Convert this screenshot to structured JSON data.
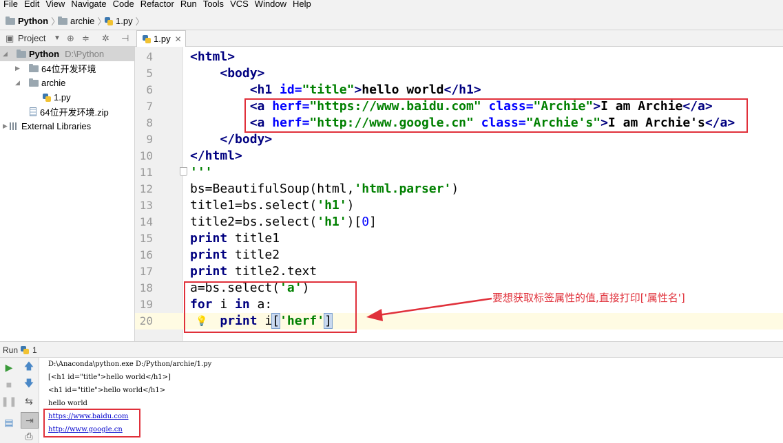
{
  "menu": [
    "File",
    "Edit",
    "View",
    "Navigate",
    "Code",
    "Refactor",
    "Run",
    "Tools",
    "VCS",
    "Window",
    "Help"
  ],
  "breadcrumb": {
    "project": "Python",
    "folder": "archie",
    "file": "1.py"
  },
  "project_panel": {
    "label": "Project",
    "tree": [
      {
        "label": "Python",
        "path": "D:\\Python"
      },
      {
        "label": "64位开发环境"
      },
      {
        "label": "archie"
      },
      {
        "label": "1.py"
      },
      {
        "label": "64位开发环境.zip"
      },
      {
        "label": "External Libraries"
      }
    ]
  },
  "editor": {
    "tab": "1.py",
    "line_numbers": [
      "4",
      "5",
      "6",
      "7",
      "8",
      "9",
      "10",
      "11",
      "12",
      "13",
      "14",
      "15",
      "16",
      "17",
      "18",
      "19",
      "20"
    ],
    "code": [
      "<html>",
      "    <body>",
      "        <h1 id=\"title\">hello world</h1>",
      "        <a herf=\"https://www.baidu.com\" class=\"Archie\">I am Archie</a>",
      "        <a herf=\"http://www.google.cn\" class=\"Archie's\">I am Archie's</a>",
      "    </body>",
      "</html>",
      "'''",
      "bs=BeautifulSoup(html,'html.parser')",
      "title1=bs.select('h1')",
      "title2=bs.select('h1')[0]",
      "print title1",
      "print title2",
      "print title2.text",
      "a=bs.select('a')",
      "for i in a:",
      "    print i['herf']"
    ],
    "annotation": "要想获取标签属性的值,直接打印['属性名']"
  },
  "run_panel": {
    "label": "Run",
    "config": "1",
    "output": [
      "D:\\Anaconda\\python.exe D:/Python/archie/1.py",
      "[<h1 id=\"title\">hello world</h1>]",
      "<h1 id=\"title\">hello world</h1>",
      "hello world",
      "https://www.baidu.com",
      "http://www.google.cn"
    ]
  },
  "colors": {
    "highlight_box": "#e0303a",
    "tag": "#000080",
    "string": "#008000",
    "attribute": "#0000ff"
  }
}
